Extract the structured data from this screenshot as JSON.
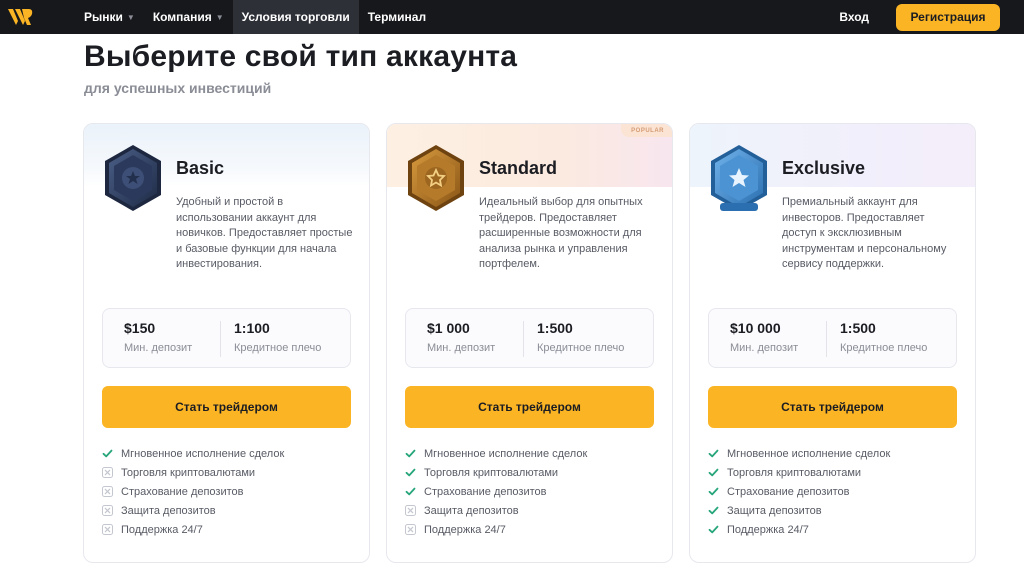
{
  "nav": {
    "logo_icon": "brand-logo-icon",
    "items": [
      {
        "label": "Рынки",
        "has_dropdown": true
      },
      {
        "label": "Компания",
        "has_dropdown": true
      },
      {
        "label": "Условия торговли",
        "has_dropdown": false,
        "active": true
      },
      {
        "label": "Терминал",
        "has_dropdown": false
      }
    ],
    "login": "Вход",
    "register": "Регистрация"
  },
  "page": {
    "title": "Выберите свой тип аккаунта",
    "subtitle": "для успешных инвестиций"
  },
  "colors": {
    "accent": "#fbb423",
    "nav_bg": "#17181c",
    "check": "#27a67a",
    "cross": "#c4c7cf"
  },
  "cards": [
    {
      "name": "Basic",
      "badge_icon": "navy-hexagon-star-badge-icon",
      "popular": "",
      "description": "Удобный и простой в использовании аккаунт для новичков. Предоставляет простые и базовые функции для начала инвестирования.",
      "stats": {
        "deposit_value": "$150",
        "deposit_label": "Мин. депозит",
        "leverage_value": "1:100",
        "leverage_label": "Кредитное плечо"
      },
      "cta": "Стать трейдером",
      "features": [
        {
          "label": "Мгновенное исполнение сделок",
          "included": true
        },
        {
          "label": "Торговля криптовалютами",
          "included": false
        },
        {
          "label": "Страхование депозитов",
          "included": false
        },
        {
          "label": "Защита депозитов",
          "included": false
        },
        {
          "label": "Поддержка 24/7",
          "included": false
        }
      ]
    },
    {
      "name": "Standard",
      "badge_icon": "bronze-hexagon-star-badge-icon",
      "popular": "POPULAR",
      "description": "Идеальный выбор для опытных трейдеров. Предоставляет расширенные возможности для анализа рынка и управления портфелем.",
      "stats": {
        "deposit_value": "$1 000",
        "deposit_label": "Мин. депозит",
        "leverage_value": "1:500",
        "leverage_label": "Кредитное плечо"
      },
      "cta": "Стать трейдером",
      "features": [
        {
          "label": "Мгновенное исполнение сделок",
          "included": true
        },
        {
          "label": "Торговля криптовалютами",
          "included": true
        },
        {
          "label": "Страхование депозитов",
          "included": true
        },
        {
          "label": "Защита депозитов",
          "included": false
        },
        {
          "label": "Поддержка 24/7",
          "included": false
        }
      ]
    },
    {
      "name": "Exclusive",
      "badge_icon": "blue-hexagon-star-badge-icon",
      "popular": "",
      "description": "Премиальный аккаунт для инвесторов. Предоставляет доступ к эксклюзивным инструментам и персональному сервису поддержки.",
      "stats": {
        "deposit_value": "$10 000",
        "deposit_label": "Мин. депозит",
        "leverage_value": "1:500",
        "leverage_label": "Кредитное плечо"
      },
      "cta": "Стать трейдером",
      "features": [
        {
          "label": "Мгновенное исполнение сделок",
          "included": true
        },
        {
          "label": "Торговля криптовалютами",
          "included": true
        },
        {
          "label": "Страхование депозитов",
          "included": true
        },
        {
          "label": "Защита депозитов",
          "included": true
        },
        {
          "label": "Поддержка 24/7",
          "included": true
        }
      ]
    }
  ]
}
